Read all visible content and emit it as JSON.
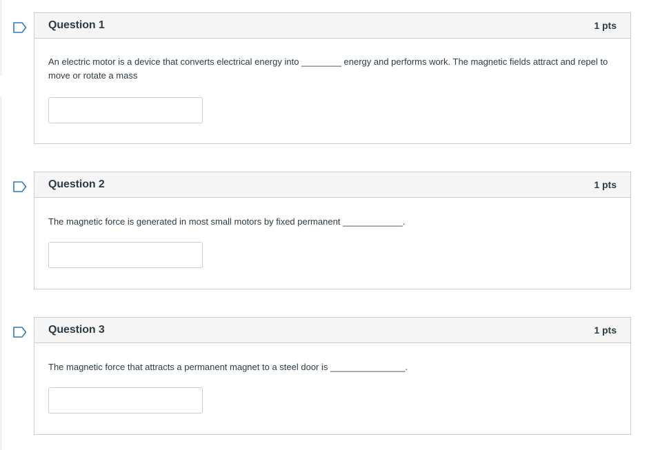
{
  "questions": [
    {
      "title": "Question 1",
      "points": "1 pts",
      "text": "An electric motor is a device that converts electrical energy into ________ energy and performs work. The magnetic fields attract and repel to move or rotate a mass",
      "answer": ""
    },
    {
      "title": "Question 2",
      "points": "1 pts",
      "text": "The magnetic force is generated in most small motors by fixed permanent ____________.",
      "answer": ""
    },
    {
      "title": "Question 3",
      "points": "1 pts",
      "text": "The magnetic force that attracts a permanent magnet to a steel door is _______________.",
      "answer": ""
    }
  ],
  "colors": {
    "flag_stroke": "#2b7abc",
    "border": "#c7cdd1",
    "header_bg": "#f5f5f5",
    "text": "#2d3b45"
  },
  "icons": {
    "flag": "flag-question-icon"
  }
}
